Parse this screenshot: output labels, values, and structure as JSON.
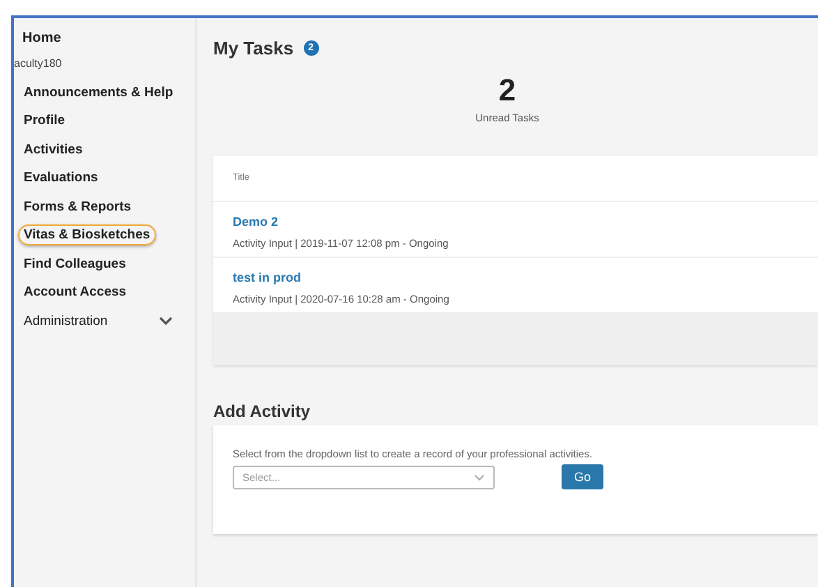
{
  "sidebar": {
    "home": "Home",
    "section": "aculty180",
    "items": [
      {
        "label": "Announcements & Help",
        "highlighted": false,
        "kind": "link"
      },
      {
        "label": "Profile",
        "highlighted": false,
        "kind": "link"
      },
      {
        "label": "Activities",
        "highlighted": false,
        "kind": "link"
      },
      {
        "label": "Evaluations",
        "highlighted": false,
        "kind": "link"
      },
      {
        "label": "Forms & Reports",
        "highlighted": false,
        "kind": "link"
      },
      {
        "label": "Vitas & Biosketches",
        "highlighted": true,
        "kind": "link"
      },
      {
        "label": "Find Colleagues",
        "highlighted": false,
        "kind": "link"
      },
      {
        "label": "Account Access",
        "highlighted": false,
        "kind": "link"
      },
      {
        "label": "Administration",
        "highlighted": false,
        "kind": "group",
        "expanded": false
      }
    ]
  },
  "tasks": {
    "title": "My Tasks",
    "badge": "2",
    "count": "2",
    "count_label": "Unread Tasks",
    "column": "Title",
    "rows": [
      {
        "title": "Demo 2",
        "meta": "Activity Input | 2019-11-07 12:08 pm - Ongoing"
      },
      {
        "title": "test in prod",
        "meta": "Activity Input | 2020-07-16 10:28 am - Ongoing"
      }
    ]
  },
  "add_activity": {
    "title": "Add Activity",
    "description": "Select from the dropdown list to create a record of your professional activities.",
    "select": {
      "placeholder": "Select..."
    },
    "button": "Go"
  }
}
